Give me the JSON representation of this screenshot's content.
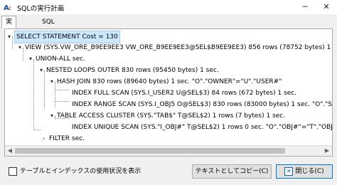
{
  "window": {
    "title": "SQLの実行計画"
  },
  "tabs": [
    {
      "label": "実行計画"
    },
    {
      "label": "SQL"
    }
  ],
  "tree": {
    "nodes": [
      {
        "text": "SELECT STATEMENT  Cost = 130"
      },
      {
        "text": "VIEW  (SYS.VW_ORE_B9EE9EE3 VW_ORE_B9EE9EE3@SEL$B9EE9EE3)  856 rows (78752 bytes)  1 sec."
      },
      {
        "text": "UNION-ALL   sec."
      },
      {
        "text": "NESTED LOOPS OUTER  830 rows (95450 bytes)  1 sec."
      },
      {
        "text": "HASH JOIN  830 rows (89640 bytes)  1 sec.  \"O\".\"OWNER\"=\"U\".\"USER#\""
      },
      {
        "text": "INDEX FULL SCAN  (SYS.I_USER2 U@SEL$3)  84 rows (672 bytes)  1 sec."
      },
      {
        "text": "INDEX RANGE SCAN  (SYS.I_OBJ5 O@SEL$3)  830 rows (83000 bytes)  1 sec.  \"O\".\"SPARE3\"=U"
      },
      {
        "text": "TABLE ACCESS CLUSTER  (SYS.\"TAB$\" T@SEL$2)  1 rows (7 bytes)  1 sec."
      },
      {
        "text": "INDEX UNIQUE SCAN  (SYS.\"I_OBJ#\" T@SEL$2)  1 rows  0 sec.  \"O\".\"OBJ#\"=\"T\".\"OBJ#\"(+)"
      },
      {
        "text": "FILTER   sec."
      }
    ]
  },
  "footer": {
    "checkbox_label": "テーブルとインデックスの使用状況を表示",
    "copy_button": "テキストとしてコピー(C)",
    "close_button": "閉じる(C)"
  }
}
